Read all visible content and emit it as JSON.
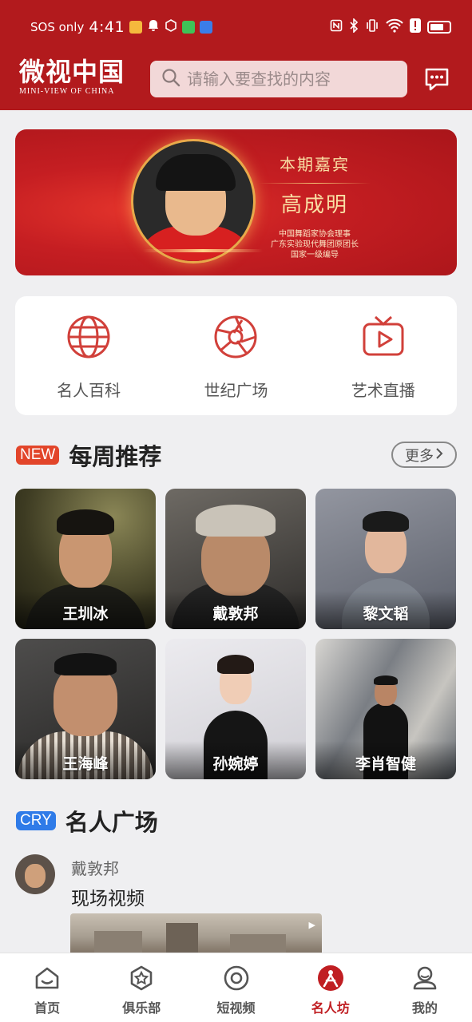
{
  "status_bar": {
    "carrier": "SOS only",
    "time": "4:41"
  },
  "header": {
    "logo_cn": "微视中国",
    "logo_en": "MINI-VIEW OF CHINA",
    "search_placeholder": "请输入要查找的内容"
  },
  "banner": {
    "title": "本期嘉宾",
    "guest_name": "高成明",
    "lines": [
      "中国舞蹈家协会理事",
      "广东实验现代舞团原团长",
      "国家一级编导"
    ]
  },
  "quick_menu": [
    {
      "label": "名人百科",
      "icon": "globe-icon"
    },
    {
      "label": "世纪广场",
      "icon": "aperture-icon"
    },
    {
      "label": "艺术直播",
      "icon": "tv-play-icon"
    }
  ],
  "weekly": {
    "badge": "NEW",
    "title": "每周推荐",
    "more": "更多",
    "people": [
      {
        "name": "王圳冰"
      },
      {
        "name": "戴敦邦"
      },
      {
        "name": "黎文韬"
      },
      {
        "name": "王海峰"
      },
      {
        "name": "孙婉婷"
      },
      {
        "name": "李肖智健"
      }
    ]
  },
  "plaza": {
    "badge": "CRY",
    "title": "名人广场",
    "post": {
      "author": "戴敦邦",
      "title": "现场视频"
    }
  },
  "tabs": [
    {
      "label": "首页",
      "icon": "home-icon"
    },
    {
      "label": "俱乐部",
      "icon": "club-star-icon"
    },
    {
      "label": "短视频",
      "icon": "short-video-icon"
    },
    {
      "label": "名人坊",
      "icon": "celebrity-icon"
    },
    {
      "label": "我的",
      "icon": "profile-icon"
    }
  ],
  "colors": {
    "brand_red": "#b21a1d",
    "new_badge": "#e2452a",
    "cry_badge": "#2f7be8",
    "active_tab": "#c01e22"
  }
}
